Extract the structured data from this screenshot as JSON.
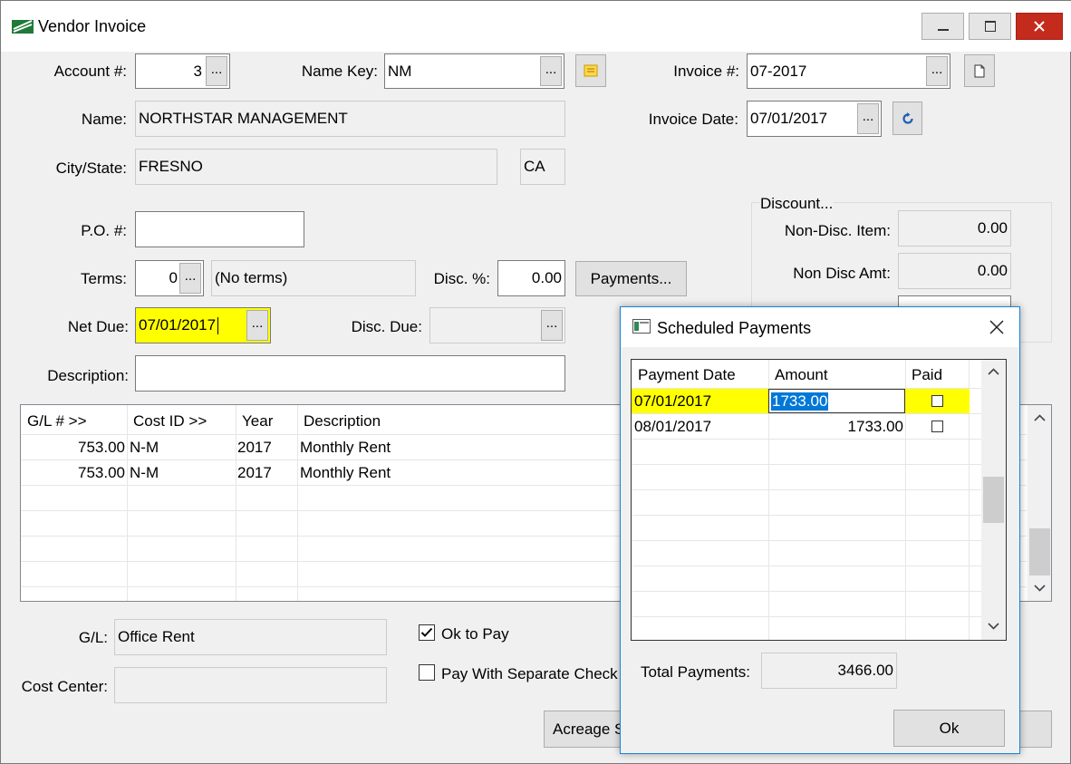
{
  "window": {
    "title": "Vendor Invoice"
  },
  "form": {
    "account_label": "Account #:",
    "account_value": "3",
    "namekey_label": "Name Key:",
    "namekey_value": "NM",
    "invoice_label": "Invoice #:",
    "invoice_value": "07-2017",
    "name_label": "Name:",
    "name_value": "NORTHSTAR MANAGEMENT",
    "invoice_date_label": "Invoice Date:",
    "invoice_date_value": "07/01/2017",
    "city_label": "City/State:",
    "city_value": "FRESNO",
    "state_value": "CA",
    "po_label": "P.O. #:",
    "po_value": "",
    "terms_label": "Terms:",
    "terms_value": "0",
    "terms_desc": "(No terms)",
    "disc_pct_label": "Disc. %:",
    "disc_pct_value": "0.00",
    "payments_button": "Payments...",
    "netdue_label": "Net Due:",
    "netdue_value": "07/01/2017",
    "discdue_label": "Disc. Due:",
    "discdue_value": "",
    "description_label": "Description:",
    "description_value": "",
    "ellipsis": "..."
  },
  "discount": {
    "group_label": "Discount...",
    "nondisc_item_label": "Non-Disc. Item:",
    "nondisc_item_value": "0.00",
    "nondisc_amt_label": "Non Disc Amt:",
    "nondisc_amt_value": "0.00"
  },
  "grid": {
    "columns": [
      "G/L # >>",
      "Cost ID >>",
      "Year",
      "Description"
    ],
    "rows": [
      {
        "gl": "753.00",
        "cost": "N-M",
        "year": "2017",
        "desc": "Monthly Rent"
      },
      {
        "gl": "753.00",
        "cost": "N-M",
        "year": "2017",
        "desc": "Monthly Rent"
      }
    ]
  },
  "bottom": {
    "gl_label": "G/L:",
    "gl_value": "Office Rent",
    "cost_center_label": "Cost Center:",
    "cost_center_value": "",
    "ok_to_pay_label": "Ok to Pay",
    "ok_to_pay_checked": true,
    "separate_check_label": "Pay With Separate Check",
    "separate_check_checked": false,
    "acreage_button": "Acreage S"
  },
  "dialog": {
    "title": "Scheduled Payments",
    "columns": [
      "Payment Date",
      "Amount",
      "Paid"
    ],
    "rows": [
      {
        "date": "07/01/2017",
        "amount": "1733.00",
        "paid": false,
        "selected": true
      },
      {
        "date": "08/01/2017",
        "amount": "1733.00",
        "paid": false,
        "selected": false
      }
    ],
    "total_label": "Total Payments:",
    "total_value": "3466.00",
    "ok_button": "Ok"
  },
  "colors": {
    "highlight_yellow": "#ffff00",
    "selection_blue": "#0078d7",
    "close_red": "#c42b1c"
  }
}
